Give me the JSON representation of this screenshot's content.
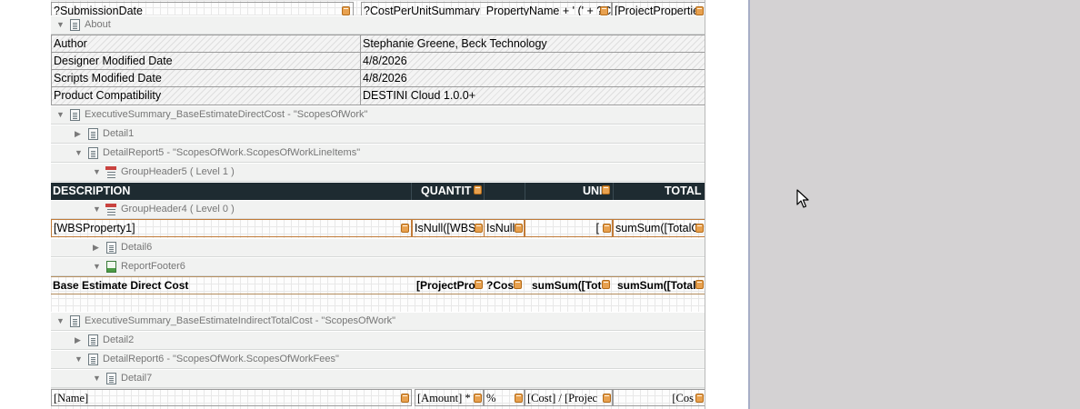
{
  "top_row": {
    "left": "?SubmissionDate",
    "mid": "?CostPerUnitSummary_PropertyName + ' (' + ?C",
    "right": "[ProjectPropertie"
  },
  "bands": {
    "about": "About",
    "exec_direct": "ExecutiveSummary_BaseEstimateDirectCost - \"ScopesOfWork\"",
    "detail1": "Detail1",
    "detail_report5": "DetailReport5 - \"ScopesOfWork.ScopesOfWorkLineItems\"",
    "group_header5": "GroupHeader5 ( Level 1 )",
    "group_header4": "GroupHeader4 ( Level 0 )",
    "detail6": "Detail6",
    "report_footer6": "ReportFooter6",
    "exec_indirect": "ExecutiveSummary_BaseEstimateIndirectTotalCost - \"ScopesOfWork\"",
    "detail2": "Detail2",
    "detail_report6": "DetailReport6 - \"ScopesOfWork.ScopesOfWorkFees\"",
    "detail7": "Detail7"
  },
  "about_table": [
    {
      "key": "Author",
      "value": "Stephanie Greene, Beck Technology"
    },
    {
      "key": "Designer Modified Date",
      "value": "4/8/2026"
    },
    {
      "key": "Scripts Modified Date",
      "value": "4/8/2026"
    },
    {
      "key": "Product Compatibility",
      "value": "DESTINI Cloud 1.0.0+"
    }
  ],
  "header_row": {
    "description": "DESCRIPTION",
    "quantity": "QUANTIT",
    "unit": "UNI",
    "total": "TOTAL"
  },
  "wbs_row": {
    "c1": "[WBSProperty1]",
    "c2": "IsNull([WBS",
    "c3": "IsNull",
    "c4": "[",
    "c5": "sumSum([TotalC"
  },
  "footer_row": {
    "c1": "Base Estimate Direct Cost",
    "c2": "[ProjectPro",
    "c3": "?Cos",
    "c4": "sumSum([Tot",
    "c5": "sumSum([Total"
  },
  "fees_row": {
    "c1": "[Name]",
    "c2": "[Amount] *",
    "c3": "%",
    "c4": "[Cost] / [Projec",
    "c5": "[Cos"
  },
  "colors": {
    "header_bg": "#1e2b31",
    "tag": "#e8a14f",
    "footer_border": "#b48d5d",
    "right_bg": "#d4d2d3"
  },
  "icons": [
    "collapse-triangle-icon",
    "expand-triangle-icon",
    "band-icon",
    "group-header-icon",
    "report-footer-icon",
    "field-tag-icon",
    "mouse-cursor-icon"
  ]
}
